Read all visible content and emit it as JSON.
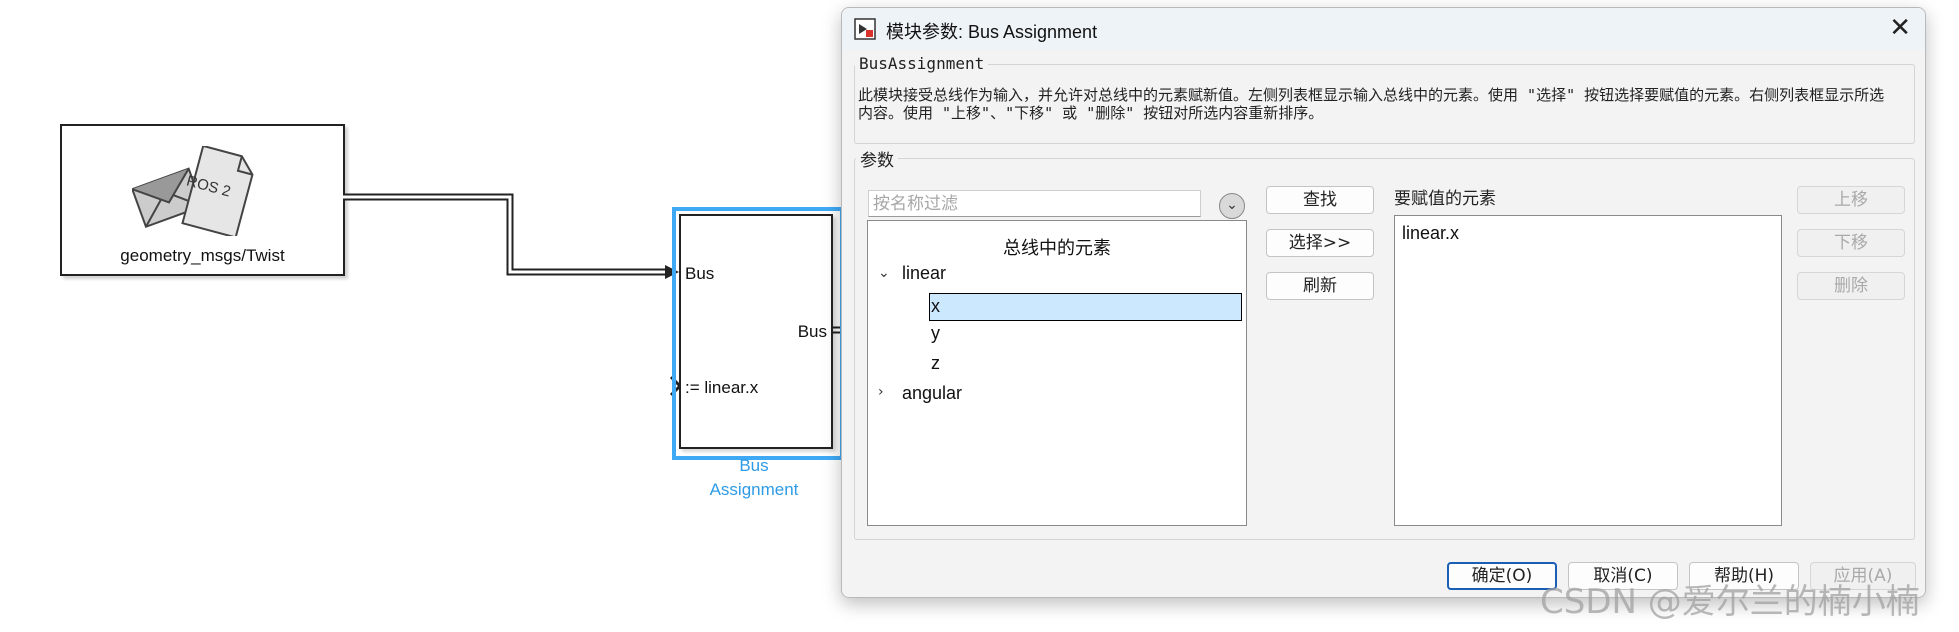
{
  "canvas": {
    "ros_block": {
      "label": "geometry_msgs/Twist",
      "logo_text": "ROS 2"
    },
    "bus_block": {
      "in_port_1": "Bus",
      "in_port_2": ":= linear.x",
      "out_port": "Bus",
      "caption_line1": "Bus",
      "caption_line2": "Assignment"
    }
  },
  "dialog": {
    "title": "模块参数: Bus Assignment",
    "group_name": "BusAssignment",
    "description": "此模块接受总线作为输入，并允许对总线中的元素赋新值。左侧列表框显示输入总线中的元素。使用 \"选择\" 按钮选择要赋值的元素。右侧列表框显示所选内容。使用 \"上移\"、\"下移\" 或 \"删除\" 按钮对所选内容重新排序。",
    "params_label": "参数",
    "filter_placeholder": "按名称过滤",
    "bus_elements_header": "总线中的元素",
    "tree": {
      "linear": {
        "label": "linear",
        "children": [
          "x",
          "y",
          "z"
        ]
      },
      "angular": {
        "label": "angular"
      }
    },
    "buttons": {
      "find": "查找",
      "select": "选择>>",
      "refresh": "刷新",
      "move_up": "上移",
      "move_down": "下移",
      "delete": "删除"
    },
    "assigned_label": "要赋值的元素",
    "assigned_elements": [
      "linear.x"
    ],
    "footer": {
      "ok": "确定(O)",
      "cancel": "取消(C)",
      "help": "帮助(H)",
      "apply": "应用(A)"
    }
  },
  "watermark": "CSDN @爱尔兰的楠小楠",
  "colors": {
    "selection_bg": "#cce8ff",
    "block_highlight": "#3fa9f5",
    "caption": "#2e9be6"
  }
}
